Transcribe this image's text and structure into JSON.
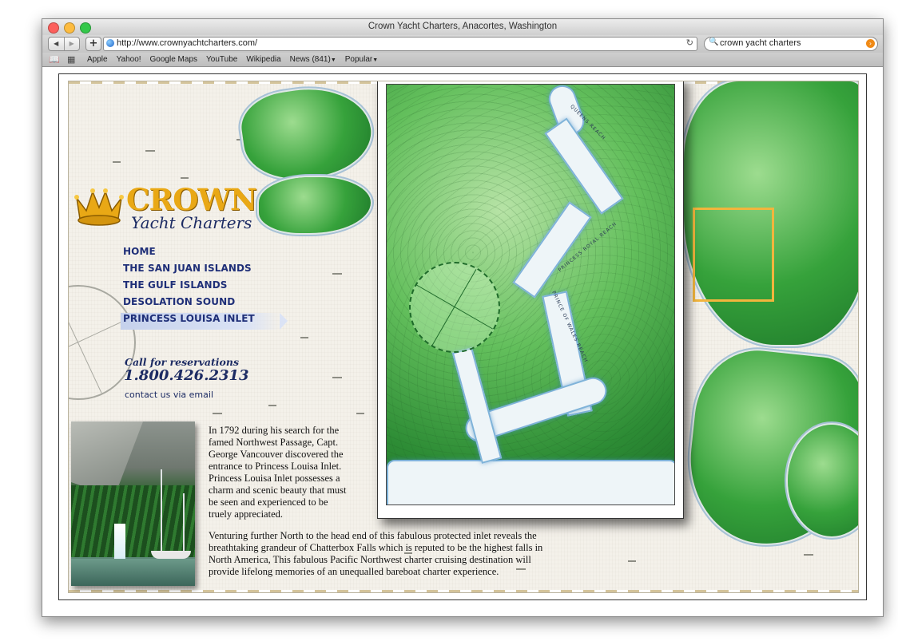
{
  "browser": {
    "title": "Crown Yacht Charters, Anacortes, Washington",
    "url": "http://www.crownyachtcharters.com/",
    "search_query": "crown yacht charters",
    "traffic_lights": {
      "close": "#fc605c",
      "minimize": "#fdbc40",
      "zoom": "#34c84a"
    },
    "bookmarks": [
      "Apple",
      "Yahoo!",
      "Google Maps",
      "YouTube",
      "Wikipedia",
      "News (841)",
      "Popular"
    ]
  },
  "site": {
    "logo_word": "CROWN",
    "logo_sub": "Yacht Charters",
    "nav": [
      "HOME",
      "THE  SAN JUAN  ISLANDS",
      "THE GULF ISLANDS",
      "DESOLATION SOUND",
      "PRINCESS LOUISA INLET"
    ],
    "active_nav": "PRINCESS LOUISA INLET",
    "call_label": "Call for reservations",
    "phone": "1.800.426.2313",
    "email_link": "contact us via email",
    "para1": "In 1792 during his search for the famed Northwest Passage, Capt. George Vancouver discovered the entrance to Princess Louisa Inlet. Princess Louisa Inlet possesses a charm and scenic beauty that must be seen and experienced to be truely appreciated.",
    "para2": "Venturing further North to the head end of this fabulous protected inlet reveals the breathtaking grandeur of Chatterbox Falls which is reputed to be the highest falls in North America, This fabulous Pacific Northwest charter cruising destination will provide lifelong memories of an unequalled bareboat charter experience.",
    "map_labels": [
      "QUEENS REACH",
      "PRINCESS ROYAL REACH",
      "PRINCE OF WALES REACH"
    ],
    "colors": {
      "gold": "#e9a815",
      "navy": "#1c2b63",
      "land": "#36a23b",
      "focus": "#f2b53d"
    }
  }
}
